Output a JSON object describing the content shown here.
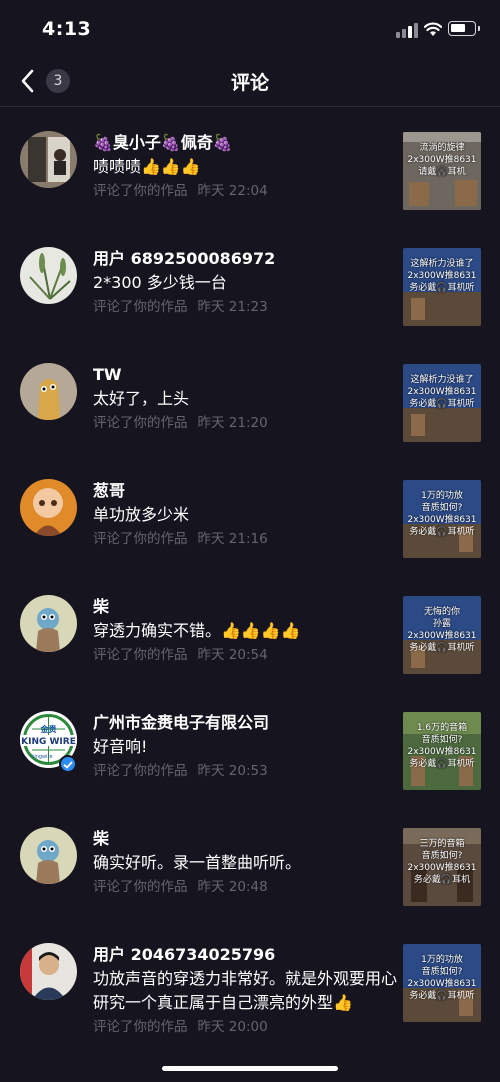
{
  "status_bar": {
    "time": "4:13"
  },
  "nav": {
    "title": "评论",
    "back_count": "3"
  },
  "comments": [
    {
      "username": "🍇臭小子🍇佩奇🍇",
      "text": "啧啧啧👍👍👍",
      "action": "评论了你的作品",
      "time": "昨天 22:04",
      "thumb_text": "流淌的旋律\n2x300W推8631\n请戴🎧耳机",
      "thumb_bg": "#6d6760"
    },
    {
      "username": "用户 6892500086972",
      "text": "2*300 多少钱一台",
      "action": "评论了你的作品",
      "time": "昨天 21:23",
      "thumb_text": "这解析力没谁了\n2x300W推8631\n务必戴🎧耳机听",
      "thumb_bg": "#2c4a86"
    },
    {
      "username": "TW",
      "text": "太好了，上头",
      "action": "评论了你的作品",
      "time": "昨天 21:20",
      "thumb_text": "这解析力没谁了\n2x300W推8631\n务必戴🎧耳机听",
      "thumb_bg": "#2c4a86"
    },
    {
      "username": "葱哥",
      "text": "单功放多少米",
      "action": "评论了你的作品",
      "time": "昨天 21:16",
      "thumb_text": "1万的功放\n音质如何?\n2x300W推8631\n务必戴🎧耳机听",
      "thumb_bg": "#2c4a86"
    },
    {
      "username": "柴",
      "text": "穿透力确实不错。👍👍👍👍",
      "action": "评论了你的作品",
      "time": "昨天 20:54",
      "thumb_text": "无悔的你\n孙露\n2x300W推8631\n务必戴🎧耳机听",
      "thumb_bg": "#2c4a86"
    },
    {
      "username": "广州市金赉电子有限公司",
      "text": "好音响!",
      "action": "评论了你的作品",
      "time": "昨天 20:53",
      "thumb_text": "1.6万的音箱\n音质如何?\n2x300W推8631\n务必戴🎧耳机听",
      "thumb_bg": "#4d6a3f",
      "verified": true
    },
    {
      "username": "柴",
      "text": "确实好听。录一首整曲听听。",
      "action": "评论了你的作品",
      "time": "昨天 20:48",
      "thumb_text": "三万的音箱\n音质如何?\n2x300W推8631\n务必戴🎧耳机",
      "thumb_bg": "#5a4a3e"
    },
    {
      "username": "用户 2046734025796",
      "text": "功放声音的穿透力非常好。就是外观要用心研究一个真正属于自己漂亮的外型👍",
      "action": "评论了你的作品",
      "time": "昨天 20:00",
      "thumb_text": "1万的功放\n音质如何?\n2x300W推8631\n务必戴🎧耳机听",
      "thumb_bg": "#2c4a86"
    }
  ],
  "avatars": {
    "0": "photo-avatar-icon",
    "1": "plant-avatar-icon",
    "2": "cartoon-avatar-icon",
    "3": "cartoon-monk-avatar-icon",
    "4": "cartoon-bird-avatar-icon",
    "5": "company-logo-avatar",
    "6": "cartoon-bird-avatar-icon",
    "7": "person-photo-avatar-icon"
  },
  "logo_text": {
    "line1": "金赉",
    "line2": "KING WIRE",
    "line3": "kingwire"
  }
}
